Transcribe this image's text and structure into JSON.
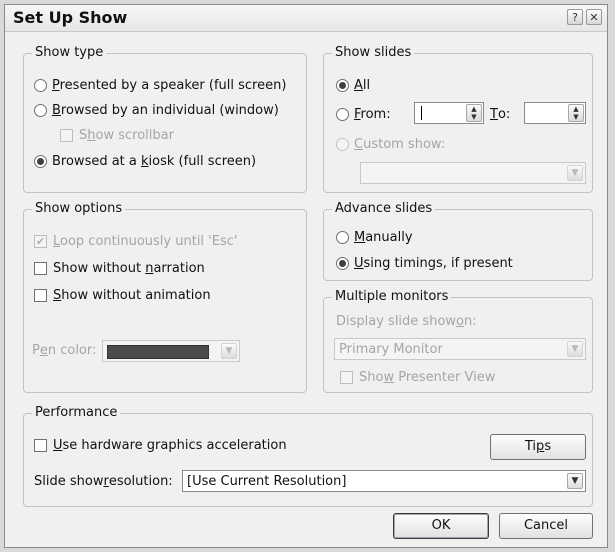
{
  "title": "Set Up Show",
  "title_buttons": {
    "help": "?",
    "close": "✕"
  },
  "show_type": {
    "legend": "Show type",
    "opt_speaker": {
      "pre": "",
      "key": "P",
      "post": "resented by a speaker (full screen)"
    },
    "opt_individual": {
      "pre": "",
      "key": "B",
      "post": "rowsed by an individual (window)"
    },
    "show_scrollbar": {
      "pre": "S",
      "key": "h",
      "post": "ow scrollbar"
    },
    "opt_kiosk": {
      "pre": "Browsed at a ",
      "key": "k",
      "post": "iosk (full screen)"
    }
  },
  "show_options": {
    "legend": "Show options",
    "loop": {
      "pre": "",
      "key": "L",
      "post": "oop continuously until 'Esc'"
    },
    "no_narration": {
      "pre": "Show without ",
      "key": "n",
      "post": "arration"
    },
    "no_animation": {
      "pre": "",
      "key": "S",
      "post": "how without animation"
    },
    "pen_color": {
      "pre": "P",
      "key": "e",
      "post": "n color:"
    }
  },
  "show_slides": {
    "legend": "Show slides",
    "all": {
      "pre": "",
      "key": "A",
      "post": "ll"
    },
    "from": {
      "pre": "",
      "key": "F",
      "post": "rom:"
    },
    "from_value": "",
    "to": {
      "pre": "",
      "key": "T",
      "post": "o:"
    },
    "to_value": "",
    "custom": {
      "pre": "",
      "key": "C",
      "post": "ustom show:"
    },
    "custom_value": ""
  },
  "advance_slides": {
    "legend": "Advance slides",
    "manually": {
      "pre": "",
      "key": "M",
      "post": "anually"
    },
    "timings": {
      "pre": "",
      "key": "U",
      "post": "sing timings, if present"
    }
  },
  "multiple_monitors": {
    "legend": "Multiple monitors",
    "display_label": {
      "pre": "Display slide show ",
      "key": "o",
      "post": "n:"
    },
    "monitor_value": "Primary Monitor",
    "presenter_view": {
      "pre": "Sho",
      "key": "w",
      "post": " Presenter View"
    }
  },
  "performance": {
    "legend": "Performance",
    "hw_accel": {
      "pre": "",
      "key": "U",
      "post": "se hardware graphics acceleration"
    },
    "tips_button": {
      "pre": "Ti",
      "key": "p",
      "post": "s"
    },
    "resolution_label": {
      "pre": "Slide show ",
      "key": "r",
      "post": "esolution:"
    },
    "resolution_value": "[Use Current Resolution]"
  },
  "buttons": {
    "ok": "OK",
    "cancel": "Cancel"
  },
  "checkmark": "✔",
  "arrow_down": "▼",
  "spin_up": "▲",
  "spin_down": "▼"
}
